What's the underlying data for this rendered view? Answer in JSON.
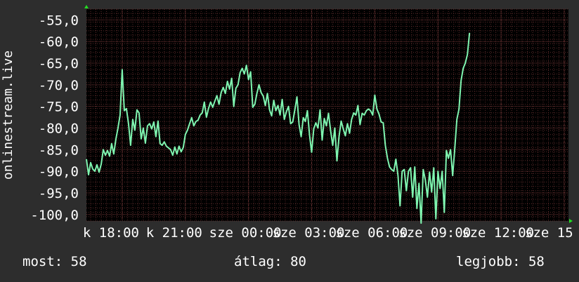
{
  "chart_data": {
    "type": "line",
    "ylabel": "onlinestream.live",
    "ylim": [
      -101.5,
      -52.5
    ],
    "yticks": [
      -55.0,
      -60.0,
      -65.0,
      -70.0,
      -75.0,
      -80.0,
      -85.0,
      -90.0,
      -95.0,
      -100.0
    ],
    "ytick_labels": [
      "-55,0",
      "-60,0",
      "-65,0",
      "-70,0",
      "-75,0",
      "-80,0",
      "-85,0",
      "-90,0",
      "-95,0",
      "-100,0"
    ],
    "xlim": [
      16.3,
      39.2
    ],
    "xticks": [
      18,
      21,
      24,
      27,
      30,
      33,
      36,
      39
    ],
    "xtick_labels": [
      "k 18:00",
      "k 21:00",
      "sze 00:00",
      "sze 03:00",
      "sze 06:00",
      "sze 09:00",
      "sze 12:00",
      "sze 15"
    ],
    "grid": true,
    "colors": {
      "line": "#7ff5b0",
      "background": "#000000",
      "grid": "#5a2a2a",
      "axis_marker": "#22dd22",
      "text": "#ffffff"
    },
    "series": [
      {
        "values": [
          [
            16.3,
            -87.2
          ],
          [
            16.4,
            -90.8
          ],
          [
            16.5,
            -88.0
          ],
          [
            16.6,
            -89.5
          ],
          [
            16.7,
            -90.0
          ],
          [
            16.8,
            -88.5
          ],
          [
            16.9,
            -90.2
          ],
          [
            17.0,
            -88.4
          ],
          [
            17.1,
            -85.0
          ],
          [
            17.2,
            -86.3
          ],
          [
            17.3,
            -85.2
          ],
          [
            17.4,
            -86.5
          ],
          [
            17.5,
            -83.6
          ],
          [
            17.6,
            -86.0
          ],
          [
            17.7,
            -82.6
          ],
          [
            17.8,
            -80.0
          ],
          [
            17.9,
            -77.0
          ],
          [
            18.0,
            -66.5
          ],
          [
            18.1,
            -76.0
          ],
          [
            18.2,
            -75.5
          ],
          [
            18.3,
            -79.0
          ],
          [
            18.4,
            -84.0
          ],
          [
            18.5,
            -78.0
          ],
          [
            18.6,
            -80.5
          ],
          [
            18.7,
            -75.8
          ],
          [
            18.8,
            -76.5
          ],
          [
            18.9,
            -82.5
          ],
          [
            19.0,
            -80.0
          ],
          [
            19.1,
            -83.5
          ],
          [
            19.2,
            -79.5
          ],
          [
            19.3,
            -79.0
          ],
          [
            19.4,
            -80.2
          ],
          [
            19.5,
            -78.6
          ],
          [
            19.6,
            -82.0
          ],
          [
            19.7,
            -78.4
          ],
          [
            19.8,
            -83.6
          ],
          [
            19.9,
            -84.0
          ],
          [
            20.0,
            -83.2
          ],
          [
            20.1,
            -84.2
          ],
          [
            20.2,
            -84.6
          ],
          [
            20.3,
            -85.0
          ],
          [
            20.4,
            -86.3
          ],
          [
            20.5,
            -84.4
          ],
          [
            20.6,
            -86.0
          ],
          [
            20.7,
            -84.2
          ],
          [
            20.8,
            -85.5
          ],
          [
            20.9,
            -84.5
          ],
          [
            21.0,
            -81.5
          ],
          [
            21.1,
            -80.5
          ],
          [
            21.2,
            -79.0
          ],
          [
            21.3,
            -77.6
          ],
          [
            21.4,
            -79.5
          ],
          [
            21.5,
            -78.5
          ],
          [
            21.6,
            -78.2
          ],
          [
            21.7,
            -77.0
          ],
          [
            21.8,
            -76.5
          ],
          [
            21.9,
            -74.0
          ],
          [
            22.0,
            -77.5
          ],
          [
            22.1,
            -75.5
          ],
          [
            22.2,
            -74.0
          ],
          [
            22.3,
            -75.2
          ],
          [
            22.4,
            -73.8
          ],
          [
            22.5,
            -72.5
          ],
          [
            22.6,
            -74.5
          ],
          [
            22.7,
            -71.8
          ],
          [
            22.8,
            -70.6
          ],
          [
            22.9,
            -72.0
          ],
          [
            23.0,
            -69.2
          ],
          [
            23.1,
            -71.0
          ],
          [
            23.2,
            -68.5
          ],
          [
            23.3,
            -75.0
          ],
          [
            23.4,
            -70.8
          ],
          [
            23.5,
            -70.0
          ],
          [
            23.6,
            -67.2
          ],
          [
            23.7,
            -66.2
          ],
          [
            23.8,
            -67.5
          ],
          [
            23.9,
            -65.5
          ],
          [
            24.0,
            -68.8
          ],
          [
            24.1,
            -67.0
          ],
          [
            24.2,
            -75.2
          ],
          [
            24.3,
            -74.5
          ],
          [
            24.4,
            -72.0
          ],
          [
            24.5,
            -70.0
          ],
          [
            24.6,
            -71.8
          ],
          [
            24.7,
            -72.6
          ],
          [
            24.8,
            -74.8
          ],
          [
            24.9,
            -72.0
          ],
          [
            25.0,
            -75.8
          ],
          [
            25.1,
            -77.2
          ],
          [
            25.2,
            -73.6
          ],
          [
            25.3,
            -76.0
          ],
          [
            25.4,
            -74.8
          ],
          [
            25.5,
            -77.0
          ],
          [
            25.6,
            -73.4
          ],
          [
            25.7,
            -78.0
          ],
          [
            25.8,
            -76.2
          ],
          [
            25.9,
            -75.0
          ],
          [
            26.0,
            -79.0
          ],
          [
            26.1,
            -78.6
          ],
          [
            26.2,
            -75.8
          ],
          [
            26.3,
            -72.8
          ],
          [
            26.4,
            -79.2
          ],
          [
            26.5,
            -82.0
          ],
          [
            26.6,
            -77.6
          ],
          [
            26.7,
            -78.5
          ],
          [
            26.8,
            -76.0
          ],
          [
            26.9,
            -81.6
          ],
          [
            27.0,
            -85.6
          ],
          [
            27.1,
            -80.2
          ],
          [
            27.2,
            -78.8
          ],
          [
            27.3,
            -80.0
          ],
          [
            27.4,
            -75.8
          ],
          [
            27.5,
            -82.8
          ],
          [
            27.6,
            -77.8
          ],
          [
            27.7,
            -79.5
          ],
          [
            27.8,
            -76.6
          ],
          [
            27.9,
            -80.6
          ],
          [
            28.0,
            -84.0
          ],
          [
            28.1,
            -80.0
          ],
          [
            28.2,
            -87.6
          ],
          [
            28.3,
            -82.0
          ],
          [
            28.4,
            -78.4
          ],
          [
            28.5,
            -80.2
          ],
          [
            28.6,
            -81.8
          ],
          [
            28.7,
            -79.0
          ],
          [
            28.8,
            -81.2
          ],
          [
            28.9,
            -78.0
          ],
          [
            29.0,
            -76.5
          ],
          [
            29.1,
            -77.0
          ],
          [
            29.2,
            -74.8
          ],
          [
            29.3,
            -79.2
          ],
          [
            29.4,
            -76.6
          ],
          [
            29.5,
            -77.0
          ],
          [
            29.6,
            -76.0
          ],
          [
            29.7,
            -75.6
          ],
          [
            29.8,
            -76.0
          ],
          [
            29.9,
            -77.0
          ],
          [
            30.0,
            -72.4
          ],
          [
            30.1,
            -75.6
          ],
          [
            30.2,
            -76.8
          ],
          [
            30.3,
            -78.6
          ],
          [
            30.4,
            -78.8
          ],
          [
            30.5,
            -84.0
          ],
          [
            30.6,
            -87.0
          ],
          [
            30.7,
            -89.0
          ],
          [
            30.8,
            -89.6
          ],
          [
            30.9,
            -90.0
          ],
          [
            31.0,
            -87.2
          ],
          [
            31.1,
            -91.0
          ],
          [
            31.2,
            -98.0
          ],
          [
            31.3,
            -90.0
          ],
          [
            31.4,
            -89.6
          ],
          [
            31.5,
            -94.5
          ],
          [
            31.6,
            -90.0
          ],
          [
            31.7,
            -89.2
          ],
          [
            31.8,
            -96.0
          ],
          [
            31.9,
            -89.0
          ],
          [
            32.0,
            -98.6
          ],
          [
            32.1,
            -92.8
          ],
          [
            32.2,
            -102.0
          ],
          [
            32.3,
            -89.6
          ],
          [
            32.4,
            -92.0
          ],
          [
            32.5,
            -96.0
          ],
          [
            32.6,
            -90.2
          ],
          [
            32.7,
            -94.8
          ],
          [
            32.8,
            -89.2
          ],
          [
            32.9,
            -101.0
          ],
          [
            33.0,
            -90.0
          ],
          [
            33.1,
            -94.0
          ],
          [
            33.2,
            -90.0
          ],
          [
            33.3,
            -99.5
          ],
          [
            33.4,
            -85.2
          ],
          [
            33.5,
            -87.0
          ],
          [
            33.6,
            -85.0
          ],
          [
            33.7,
            -91.0
          ],
          [
            33.8,
            -84.8
          ],
          [
            33.9,
            -78.0
          ],
          [
            34.0,
            -75.6
          ],
          [
            34.1,
            -69.0
          ],
          [
            34.2,
            -66.2
          ],
          [
            34.3,
            -65.0
          ],
          [
            34.4,
            -63.0
          ],
          [
            34.5,
            -58.0
          ]
        ]
      }
    ]
  },
  "footer": {
    "current": "most: 58",
    "average": "átlag: 80",
    "best": "legjobb: 58"
  }
}
